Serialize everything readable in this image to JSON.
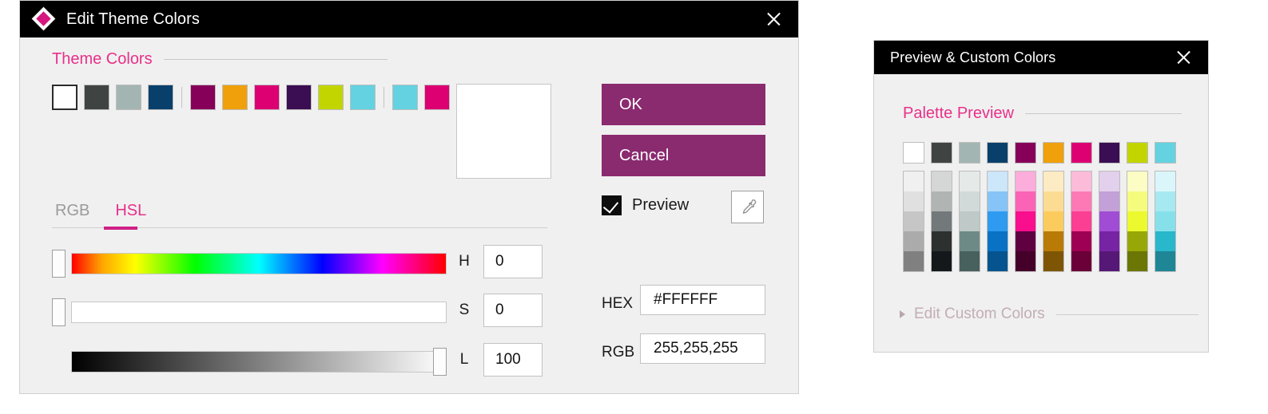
{
  "main_dialog": {
    "title": "Edit Theme Colors",
    "icon": "diamond-logo-icon",
    "close_icon": "close-icon",
    "theme_colors": {
      "heading": "Theme Colors",
      "swatches": [
        {
          "name": "white",
          "hex": "#FFFFFF",
          "selected": true
        },
        {
          "name": "dark-gray",
          "hex": "#3F4443",
          "selected": false
        },
        {
          "name": "gray-green",
          "hex": "#A3B5B2",
          "selected": false
        },
        {
          "name": "navy",
          "hex": "#09406B",
          "selected": false
        },
        {
          "name": "separator",
          "hex": "",
          "selected": false
        },
        {
          "name": "dark-magenta",
          "hex": "#86005A",
          "selected": false
        },
        {
          "name": "orange",
          "hex": "#EFA00B",
          "selected": false
        },
        {
          "name": "pink",
          "hex": "#DC0073",
          "selected": false
        },
        {
          "name": "dark-purple",
          "hex": "#3B0D52",
          "selected": false
        },
        {
          "name": "lime",
          "hex": "#C2D500",
          "selected": false
        },
        {
          "name": "cyan",
          "hex": "#64D2E0",
          "selected": false
        },
        {
          "name": "separator",
          "hex": "",
          "selected": false
        },
        {
          "name": "cyan-alt",
          "hex": "#64D2E0",
          "selected": false
        },
        {
          "name": "pink-alt",
          "hex": "#DC0073",
          "selected": false
        }
      ]
    },
    "color_preview": {
      "hex": "#FFFFFF"
    },
    "tabs": [
      {
        "label": "RGB",
        "active": false
      },
      {
        "label": "HSL",
        "active": true
      }
    ],
    "sliders": [
      {
        "channel": "H",
        "value": "0",
        "thumb_percent": 0,
        "track": "hue"
      },
      {
        "channel": "S",
        "value": "0",
        "thumb_percent": 0,
        "track": "saturation"
      },
      {
        "channel": "L",
        "value": "100",
        "thumb_percent": 100,
        "track": "luminance"
      }
    ],
    "actions": {
      "ok_label": "OK",
      "cancel_label": "Cancel",
      "button_color": "#8A2A6F",
      "preview_label": "Preview",
      "preview_checked": true,
      "eyedropper_icon": "eyedropper-icon"
    },
    "fields": [
      {
        "label": "HEX",
        "value": "#FFFFFF"
      },
      {
        "label": "RGB",
        "value": "255,255,255"
      }
    ]
  },
  "preview_dialog": {
    "title": "Preview & Custom Colors",
    "close_icon": "close-icon",
    "palette_heading": "Palette Preview",
    "edit_custom_label": "Edit Custom Colors",
    "disclosure_icon": "triangle-right-icon",
    "palette_columns": [
      {
        "name": "white",
        "base": "#FFFFFF",
        "tints": [
          "#F0F0F0",
          "#E0E0E0",
          "#C6C6C6",
          "#ABABAB",
          "#808080"
        ]
      },
      {
        "name": "dark-gray",
        "base": "#3F4443",
        "tints": [
          "#D5D6D6",
          "#B0B4B3",
          "#73797A",
          "#2C3130",
          "#14181A"
        ]
      },
      {
        "name": "gray-green",
        "base": "#A3B5B2",
        "tints": [
          "#E5EAE9",
          "#D2DAD9",
          "#BFC9C7",
          "#6E8A86",
          "#48605E"
        ]
      },
      {
        "name": "navy",
        "base": "#09406B",
        "tints": [
          "#CCE6FA",
          "#86C4F7",
          "#2E9BF0",
          "#0A72C4",
          "#05548F"
        ]
      },
      {
        "name": "dark-magenta",
        "base": "#86005A",
        "tints": [
          "#FCADDB",
          "#FB63B6",
          "#F90E8E",
          "#5F0040",
          "#450029"
        ]
      },
      {
        "name": "orange",
        "base": "#EFA00B",
        "tints": [
          "#FDEBC3",
          "#FBDC92",
          "#FBCB5E",
          "#B97B05",
          "#7E5504"
        ]
      },
      {
        "name": "pink",
        "base": "#DC0073",
        "tints": [
          "#FDBBDA",
          "#FC79B6",
          "#FB3F93",
          "#9E0053",
          "#6B0039"
        ]
      },
      {
        "name": "dark-purple",
        "base": "#3B0D52",
        "tints": [
          "#E2D0EC",
          "#C3A0D8",
          "#A04CD4",
          "#7724A4",
          "#561877"
        ]
      },
      {
        "name": "lime",
        "base": "#C2D500",
        "tints": [
          "#FBFDC4",
          "#F5FB7D",
          "#EBF92E",
          "#97A705",
          "#6B7604"
        ]
      },
      {
        "name": "cyan",
        "base": "#64D2E0",
        "tints": [
          "#DAF6FA",
          "#A7E9F1",
          "#86E0EA",
          "#28B7CB",
          "#1E8695"
        ]
      }
    ]
  }
}
